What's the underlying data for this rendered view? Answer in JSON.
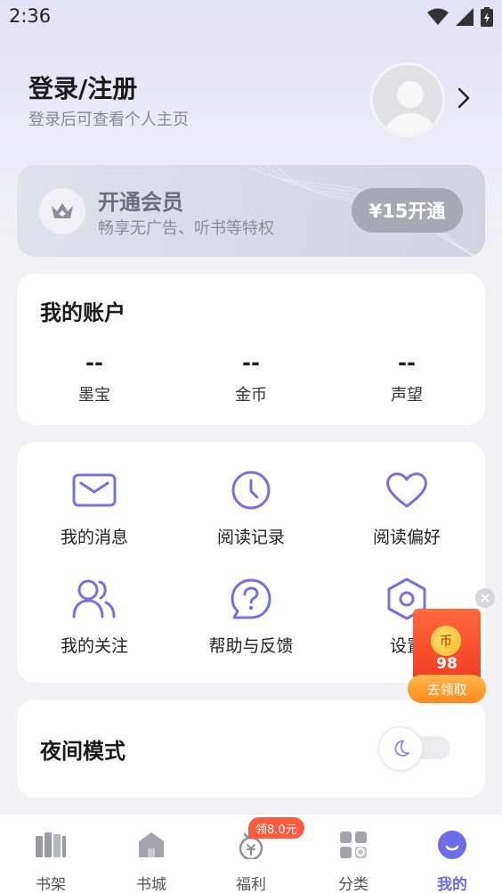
{
  "status_bar": {
    "time": "2:36"
  },
  "header": {
    "login_title": "登录/注册",
    "login_subtitle": "登录后可查看个人主页"
  },
  "vip": {
    "title": "开通会员",
    "subtitle": "畅享无广告、听书等特权",
    "button": "¥15开通"
  },
  "account": {
    "title": "我的账户",
    "items": [
      {
        "value": "--",
        "label": "墨宝"
      },
      {
        "value": "--",
        "label": "金币"
      },
      {
        "value": "--",
        "label": "声望"
      }
    ]
  },
  "menu": {
    "items": [
      {
        "label": "我的消息",
        "icon": "mail-icon"
      },
      {
        "label": "阅读记录",
        "icon": "clock-icon"
      },
      {
        "label": "阅读偏好",
        "icon": "heart-icon"
      },
      {
        "label": "我的关注",
        "icon": "users-icon"
      },
      {
        "label": "帮助与反馈",
        "icon": "help-icon"
      },
      {
        "label": "设置",
        "icon": "settings-icon"
      }
    ]
  },
  "night_mode": {
    "label": "夜间模式",
    "enabled": false
  },
  "reward": {
    "coin_glyph": "币",
    "amount": "98",
    "button": "去领取"
  },
  "bottom_nav": {
    "items": [
      {
        "label": "书架",
        "icon": "bookshelf-icon"
      },
      {
        "label": "书城",
        "icon": "bookstore-icon"
      },
      {
        "label": "福利",
        "icon": "welfare-icon",
        "badge": "领8.0元"
      },
      {
        "label": "分类",
        "icon": "category-icon"
      },
      {
        "label": "我的",
        "icon": "profile-icon",
        "active": true
      }
    ]
  },
  "colors": {
    "accent": "#6d6de8",
    "badge": "#ff5a3c"
  }
}
